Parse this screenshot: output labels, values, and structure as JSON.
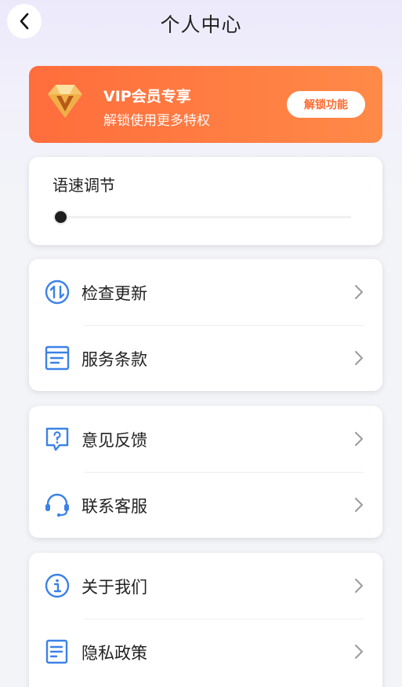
{
  "header": {
    "title": "个人中心"
  },
  "vip": {
    "title": "VIP会员专享",
    "subtitle": "解锁使用更多特权",
    "button_label": "解锁功能"
  },
  "speed": {
    "title": "语速调节",
    "value": 0
  },
  "groups": [
    {
      "items": [
        {
          "label": "检查更新",
          "icon": "update-icon"
        },
        {
          "label": "服务条款",
          "icon": "document-icon"
        }
      ]
    },
    {
      "items": [
        {
          "label": "意见反馈",
          "icon": "feedback-icon"
        },
        {
          "label": "联系客服",
          "icon": "headset-icon"
        }
      ]
    },
    {
      "items": [
        {
          "label": "关于我们",
          "icon": "info-icon"
        },
        {
          "label": "隐私政策",
          "icon": "privacy-doc-icon"
        }
      ]
    }
  ],
  "colors": {
    "accent": "#3b82e6",
    "vip_start": "#ff6d3c",
    "vip_end": "#ff8a47",
    "vip_button_text": "#ff6a2e"
  }
}
